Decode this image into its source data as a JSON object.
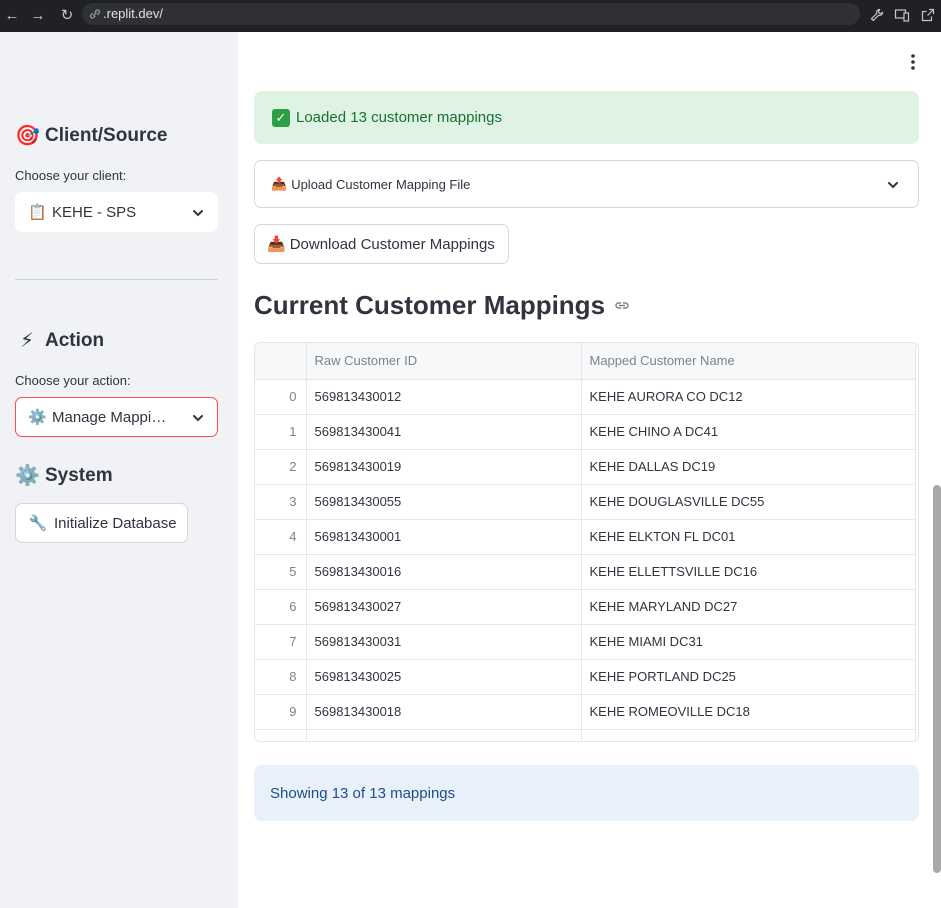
{
  "browser": {
    "url": ".replit.dev/",
    "back_icon": "arrow-left-icon",
    "forward_icon": "arrow-right-icon",
    "reload_icon": "reload-icon"
  },
  "sidebar": {
    "client_section": {
      "emoji": "🎯",
      "title": "Client/Source"
    },
    "client_label": "Choose your client:",
    "client_select": {
      "emoji": "📋",
      "value": "KEHE - SPS"
    },
    "action_section": {
      "emoji": "⚡",
      "title": "Action"
    },
    "action_label": "Choose your action:",
    "action_select": {
      "emoji": "⚙️",
      "value": "Manage Mappi…"
    },
    "system_section": {
      "emoji": "⚙️",
      "title": "System"
    },
    "init_button": {
      "emoji": "🔧",
      "label": "Initialize Database"
    }
  },
  "main": {
    "success_message": "Loaded 13 customer mappings",
    "upload_expander": {
      "emoji": "📤",
      "label": "Upload Customer Mapping File"
    },
    "download_button": {
      "emoji": "📥",
      "label": "Download Customer Mappings"
    },
    "title": "Current Customer Mappings",
    "table": {
      "columns": [
        "",
        "Raw Customer ID",
        "Mapped Customer Name"
      ],
      "rows": [
        [
          "0",
          "569813430012",
          "KEHE AURORA CO DC12"
        ],
        [
          "1",
          "569813430041",
          "KEHE CHINO A DC41"
        ],
        [
          "2",
          "569813430019",
          "KEHE DALLAS DC19"
        ],
        [
          "3",
          "569813430055",
          "KEHE DOUGLASVILLE DC55"
        ],
        [
          "4",
          "569813430001",
          "KEHE ELKTON FL DC01"
        ],
        [
          "5",
          "569813430016",
          "KEHE ELLETTSVILLE DC16"
        ],
        [
          "6",
          "569813430027",
          "KEHE MARYLAND DC27"
        ],
        [
          "7",
          "569813430031",
          "KEHE MIAMI DC31"
        ],
        [
          "8",
          "569813430025",
          "KEHE PORTLAND DC25"
        ],
        [
          "9",
          "569813430018",
          "KEHE ROMEOVILLE DC18"
        ]
      ]
    },
    "info_message": "Showing 13 of 13 mappings"
  },
  "colors": {
    "sidebar_bg": "#f0f2f6",
    "accent": "#ff4b4b",
    "success_bg": "#dff3e4",
    "success_text": "#177233",
    "info_bg": "#e8f1fb",
    "info_text": "#1d4e89"
  }
}
